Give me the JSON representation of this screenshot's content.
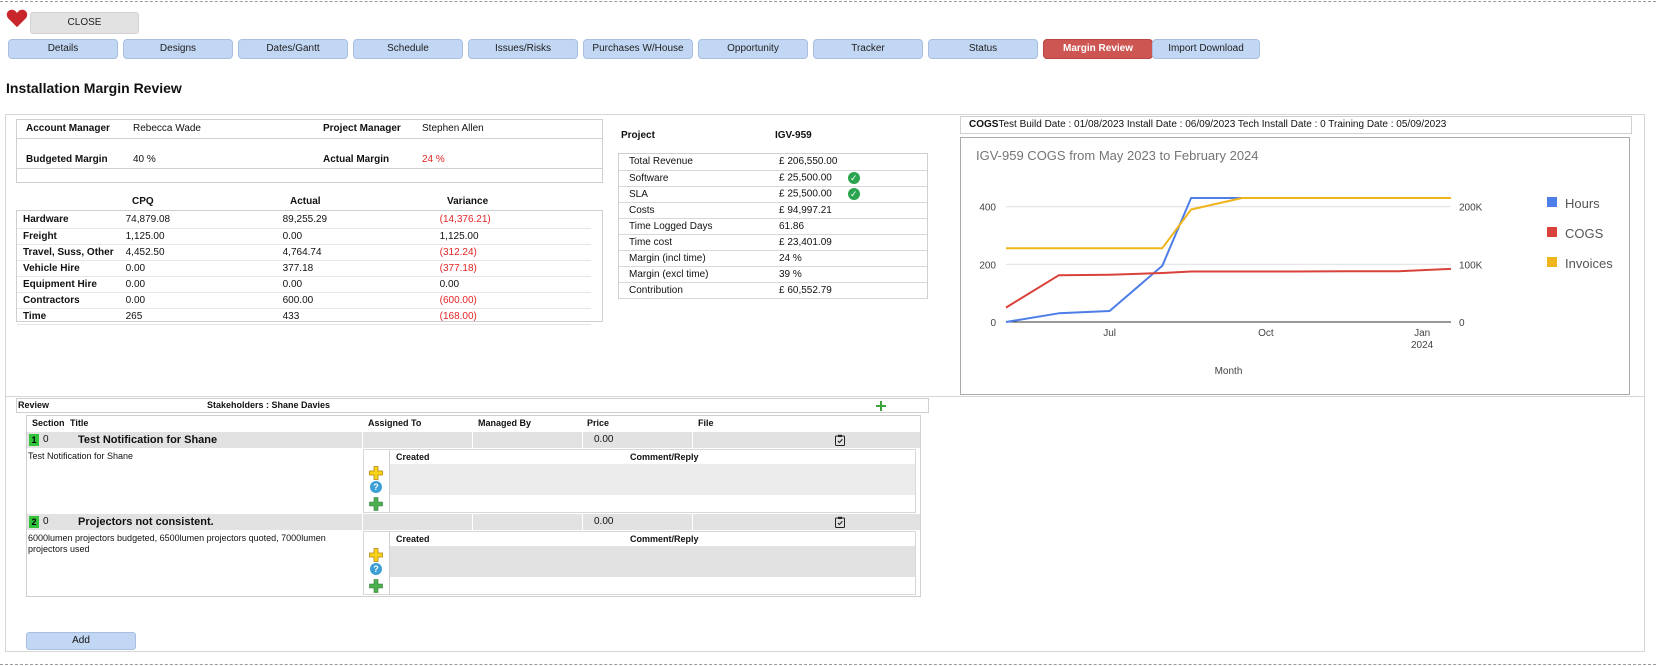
{
  "header": {
    "close_label": "CLOSE",
    "tabs": [
      "Details",
      "Designs",
      "Dates/Gantt",
      "Schedule",
      "Issues/Risks",
      "Purchases W/House",
      "Opportunity",
      "Tracker",
      "Status",
      "Margin Review",
      "Import Download"
    ],
    "active_tab": "Margin Review"
  },
  "page_title": "Installation Margin Review",
  "summary": {
    "account_manager_label": "Account Manager",
    "account_manager": "Rebecca Wade",
    "project_manager_label": "Project Manager",
    "project_manager": "Stephen Allen",
    "budgeted_margin_label": "Budgeted Margin",
    "budgeted_margin": "40 %",
    "actual_margin_label": "Actual Margin",
    "actual_margin": "24 %"
  },
  "margin_table": {
    "headers": [
      "CPQ",
      "Actual",
      "Variance"
    ],
    "rows": [
      {
        "label": "Hardware",
        "cpq": "74,879.08",
        "actual": "89,255.29",
        "variance": "(14,376.21)",
        "neg": true
      },
      {
        "label": "Freight",
        "cpq": "1,125.00",
        "actual": "0.00",
        "variance": "1,125.00",
        "neg": false
      },
      {
        "label": "Travel, Suss, Other",
        "cpq": "4,452.50",
        "actual": "4,764.74",
        "variance": "(312.24)",
        "neg": true
      },
      {
        "label": "Vehicle Hire",
        "cpq": "0.00",
        "actual": "377.18",
        "variance": "(377.18)",
        "neg": true
      },
      {
        "label": "Equipment Hire",
        "cpq": "0.00",
        "actual": "0.00",
        "variance": "0.00",
        "neg": false
      },
      {
        "label": "Contractors",
        "cpq": "0.00",
        "actual": "600.00",
        "variance": "(600.00)",
        "neg": true
      },
      {
        "label": "Time",
        "cpq": "265",
        "actual": "433",
        "variance": "(168.00)",
        "neg": true
      }
    ]
  },
  "project": {
    "label": "Project",
    "code": "IGV-959",
    "rows": [
      {
        "label": "Total Revenue",
        "value": "£ 206,550.00",
        "check": false
      },
      {
        "label": "Software",
        "value": "£ 25,500.00",
        "check": true
      },
      {
        "label": "SLA",
        "value": "£ 25,500.00",
        "check": true
      },
      {
        "label": "Costs",
        "value": "£ 94,997.21",
        "check": false
      },
      {
        "label": "Time Logged Days",
        "value": "61.86",
        "check": false
      },
      {
        "label": "Time cost",
        "value": "£ 23,401.09",
        "check": false
      },
      {
        "label": "Margin (incl time)",
        "value": "24 %",
        "check": false
      },
      {
        "label": "Margin (excl time)",
        "value": "39 %",
        "check": false
      },
      {
        "label": "Contribution",
        "value": "£ 60,552.79",
        "check": false
      }
    ]
  },
  "cogs_header": {
    "label": "COGS",
    "text": "Test Build Date : 01/08/2023 Install Date : 06/09/2023 Tech Install Date : 0 Training Date : 05/09/2023"
  },
  "chart_data": {
    "type": "line",
    "title": "IGV-959 COGS from May 2023 to February 2024",
    "xlabel": "Month",
    "x": [
      "2023-05-15",
      "2023-06-15",
      "2023-07-15",
      "2023-08-15",
      "2023-09-01",
      "2023-10-01",
      "2023-11-01",
      "2023-12-01",
      "2024-01-01",
      "2024-02-01"
    ],
    "x_ticks": [
      "Jul",
      "Oct",
      "Jan",
      "2024"
    ],
    "y_left_ticks": [
      "0",
      "200",
      "400"
    ],
    "y_right_ticks": [
      "0",
      "100K",
      "200K"
    ],
    "ylim_left": [
      0,
      430
    ],
    "ylim_right": [
      0,
      215000
    ],
    "series": [
      {
        "name": "Hours",
        "color": "#4d7ee8",
        "axis": "left",
        "values": [
          0,
          30,
          38,
          195,
          430,
          430,
          430,
          430,
          430,
          430
        ]
      },
      {
        "name": "COGS",
        "color": "#d9423a",
        "axis": "right",
        "values": [
          25000,
          81000,
          82000,
          85000,
          87500,
          87500,
          87500,
          88000,
          88000,
          92000
        ]
      },
      {
        "name": "Invoices",
        "color": "#f0b41c",
        "axis": "right",
        "values": [
          128000,
          128000,
          128000,
          128000,
          195000,
          215000,
          215000,
          215000,
          215000,
          215000
        ]
      }
    ],
    "legend_position": "right"
  },
  "review": {
    "label": "Review",
    "stakeholders": "Stakeholders : Shane Davies",
    "columns": [
      "Section",
      "Title",
      "Assigned To",
      "Managed By",
      "Price",
      "File"
    ],
    "comment_columns": [
      "Created",
      "Comment/Reply"
    ],
    "items": [
      {
        "num": "1",
        "section": "0",
        "title": "Test Notification for Shane",
        "price": "0.00",
        "description": "Test Notification for Shane"
      },
      {
        "num": "2",
        "section": "0",
        "title": "Projectors not consistent.",
        "price": "0.00",
        "description": "6000lumen projectors budgeted, 6500lumen projectors quoted, 7000lumen projectors used"
      }
    ],
    "add_label": "Add"
  },
  "colors": {
    "accent_tab": "#cd5552",
    "tab": "#c2d7f3",
    "negative": "#e32525",
    "success": "#2aa44e"
  }
}
